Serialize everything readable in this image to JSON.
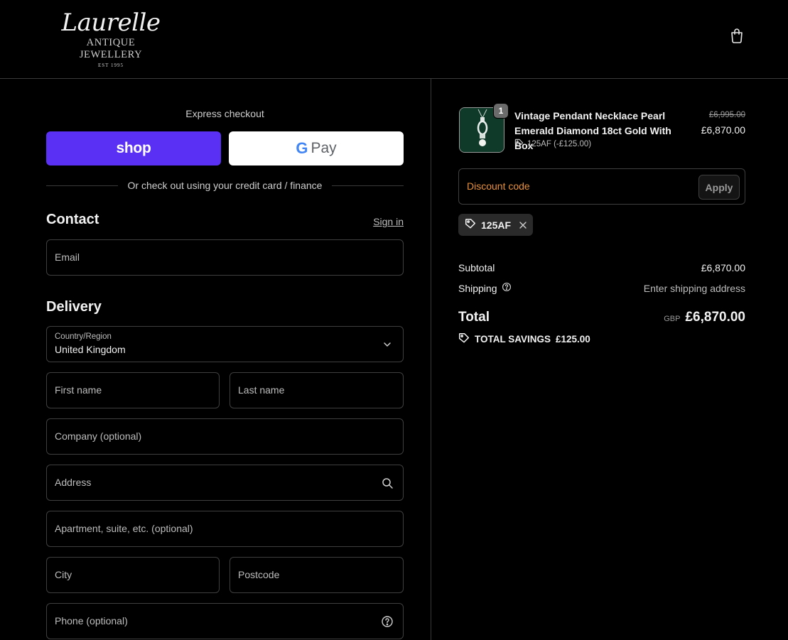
{
  "brand": {
    "script": "Laurelle",
    "subtitle": "ANTIQUE JEWELLERY",
    "est": "EST 1995"
  },
  "express": {
    "label": "Express checkout",
    "shop_label": "shop",
    "gpay_g": "G",
    "gpay_label": "Pay",
    "or_text": "Or check out using your credit card / finance"
  },
  "contact": {
    "title": "Contact",
    "signin": "Sign in",
    "email_placeholder": "Email"
  },
  "delivery": {
    "title": "Delivery",
    "country_label": "Country/Region",
    "country_value": "United Kingdom",
    "first_name": "First name",
    "last_name": "Last name",
    "company": "Company (optional)",
    "address": "Address",
    "apartment": "Apartment, suite, etc. (optional)",
    "city": "City",
    "postcode": "Postcode",
    "phone": "Phone (optional)"
  },
  "order": {
    "quantity": "1",
    "product_name": "Vintage Pendant Necklace Pearl Emerald Diamond 18ct Gold With Box",
    "product_discount": "125AF (-£125.00)",
    "price_old": "£6,995.00",
    "price_new": "£6,870.00",
    "discount_placeholder": "Discount code",
    "apply_label": "Apply",
    "applied_code": "125AF",
    "subtotal_label": "Subtotal",
    "subtotal_value": "£6,870.00",
    "shipping_label": "Shipping",
    "shipping_value": "Enter shipping address",
    "total_label": "Total",
    "currency": "GBP",
    "total_value": "£6,870.00",
    "savings_label": "TOTAL SAVINGS",
    "savings_value": "£125.00"
  },
  "colors": {
    "shop_purple": "#5a31f4",
    "discount_placeholder": "#e8913a",
    "background": "#000000"
  }
}
